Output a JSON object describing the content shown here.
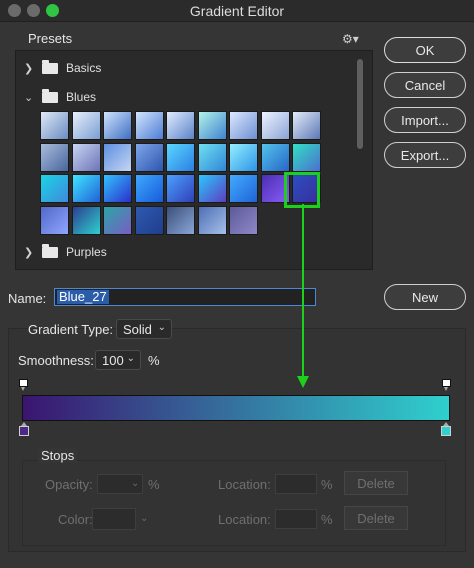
{
  "window": {
    "title": "Gradient Editor"
  },
  "presets": {
    "label": "Presets",
    "folders": [
      {
        "label": "Basics",
        "expanded": false
      },
      {
        "label": "Blues",
        "expanded": true
      },
      {
        "label": "Purples",
        "expanded": false
      }
    ],
    "swatches": [
      [
        "#dfe9f7",
        "#6a8bc1"
      ],
      [
        "#e8effa",
        "#7a9ed3"
      ],
      [
        "#cfe3fb",
        "#3f6fc4"
      ],
      [
        "#d3e4fb",
        "#4c7dd6"
      ],
      [
        "#e1ecff",
        "#5a83c7"
      ],
      [
        "#b5f1ea",
        "#3c84cf"
      ],
      [
        "#dde8ff",
        "#6c8fd2"
      ],
      [
        "#eef3ff",
        "#8aa4d6"
      ],
      [
        "#e4ecf8",
        "#5c79b6"
      ],
      [
        "#a9bcdb",
        "#48669d"
      ],
      [
        "#c8d4f2",
        "#6c74b8"
      ],
      [
        "#5c8fe0",
        "#c6d6f4"
      ],
      [
        "#7fa6e8",
        "#2c56b0"
      ],
      [
        "#5ad7ff",
        "#2b7fe4"
      ],
      [
        "#6fe0f2",
        "#2f86d6"
      ],
      [
        "#94f0ff",
        "#2e93e6"
      ],
      [
        "#53c4ea",
        "#2765c8"
      ],
      [
        "#31e0c3",
        "#4b6fd0"
      ],
      [
        "#1ad5e6",
        "#3f89dc"
      ],
      [
        "#3fe6ff",
        "#2160d8"
      ],
      [
        "#33c2ff",
        "#2a2fcc"
      ],
      [
        "#3fa9ff",
        "#175ad8"
      ],
      [
        "#4ba0ff",
        "#3140b8"
      ],
      [
        "#2cc7ff",
        "#5c3ec0"
      ],
      [
        "#44aaff",
        "#1e64d6"
      ],
      [
        "#4a2fb4",
        "#8b5cf6"
      ],
      [
        "#2b4fc0",
        "#3a2d9c"
      ],
      [
        "#5368c8",
        "#8fa6ff"
      ],
      [
        "#2c3f8f",
        "#2ed0d0"
      ],
      [
        "#2aa6a6",
        "#7a5cc4"
      ],
      [
        "#2f5ab0",
        "#1f3d8c"
      ],
      [
        "#3c4f7a",
        "#8aa7d8"
      ],
      [
        "#4e6fb5",
        "#a6c0e8"
      ],
      [
        "#5d5a9a",
        "#8f88c8"
      ]
    ]
  },
  "buttons": {
    "ok": "OK",
    "cancel": "Cancel",
    "import": "Import...",
    "export": "Export...",
    "new": "New"
  },
  "name": {
    "label": "Name:",
    "value": "Blue_27"
  },
  "gradient": {
    "type_label": "Gradient Type:",
    "type_value": "Solid",
    "smoothness_label": "Smoothness:",
    "smoothness_value": "100",
    "smoothness_unit": "%",
    "start_color": "#3a1570",
    "end_color": "#2fd0ce",
    "start_stop_color": "#4e2887",
    "end_stop_color": "#2fd0ce",
    "opacity_stop_color": "#ffffff"
  },
  "stops": {
    "label": "Stops",
    "opacity_label": "Opacity:",
    "opacity_unit": "%",
    "location_label_1": "Location:",
    "location_unit_1": "%",
    "delete_1": "Delete",
    "color_label": "Color:",
    "location_label_2": "Location:",
    "location_unit_2": "%",
    "delete_2": "Delete"
  },
  "annotation": {
    "color": "#1bd11b"
  }
}
